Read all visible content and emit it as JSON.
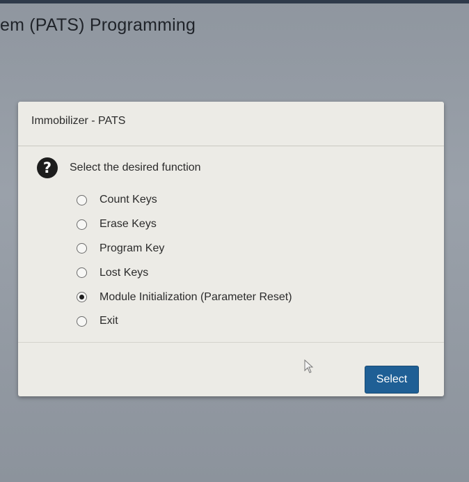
{
  "page": {
    "title": "em (PATS) Programming"
  },
  "dialog": {
    "title": "Immobilizer - PATS",
    "prompt": "Select the desired function",
    "options": [
      {
        "label": "Count Keys",
        "selected": false
      },
      {
        "label": "Erase Keys",
        "selected": false
      },
      {
        "label": "Program Key",
        "selected": false
      },
      {
        "label": "Lost Keys",
        "selected": false
      },
      {
        "label": "Module Initialization (Parameter Reset)",
        "selected": true
      },
      {
        "label": "Exit",
        "selected": false
      }
    ],
    "select_button": "Select"
  },
  "icons": {
    "help": "question-circle-icon",
    "cursor": "mouse-pointer-icon"
  },
  "colors": {
    "button_bg": "#1f5f95",
    "dialog_bg": "#ecebe6",
    "page_bg": "#9aa1aa"
  }
}
